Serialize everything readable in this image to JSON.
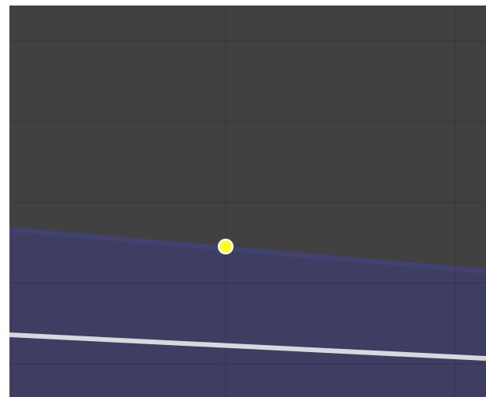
{
  "viewport": {
    "background": "#414141",
    "grid_color": "#363636",
    "shader_region_color": "#3e3d62",
    "shader_edge_color": "#49497a",
    "curve_color": "#d8d8e0",
    "point_color": "#ffff1a",
    "point_outline_color": "#ffffff",
    "icons": {
      "control_point": "control-point-icon"
    }
  }
}
